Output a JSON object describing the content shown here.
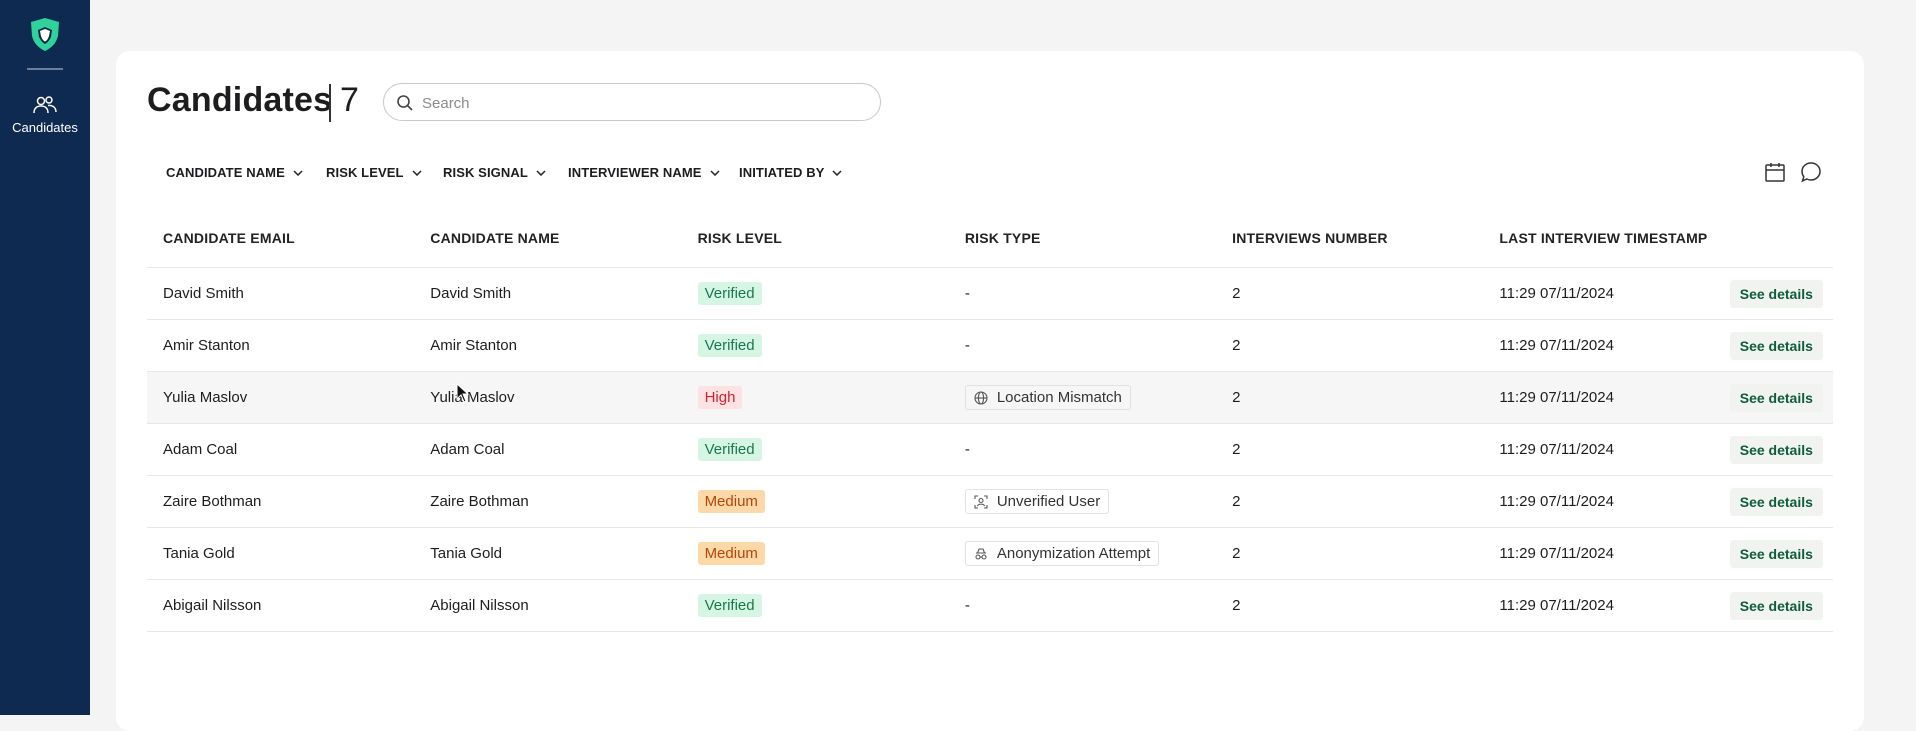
{
  "sidebar": {
    "logo_icon": "shield-logo",
    "items": [
      {
        "label": "Candidates",
        "icon": "users-icon"
      }
    ]
  },
  "header": {
    "title": "Candidates",
    "count": "7"
  },
  "search": {
    "placeholder": "Search",
    "value": ""
  },
  "filters": [
    "CANDIDATE NAME",
    "RISK LEVEL",
    "RISK SIGNAL",
    "INTERVIEWER NAME",
    "INITIATED BY"
  ],
  "table": {
    "headers": [
      "CANDIDATE EMAIL",
      "CANDIDATE NAME",
      "RISK LEVEL",
      "RISK TYPE",
      "INTERVIEWS NUMBER",
      "LAST INTERVIEW TIMESTAMP"
    ],
    "rows": [
      {
        "email": "David Smith",
        "name": "David Smith",
        "risk": "Verified",
        "risk_type": "-",
        "risk_type_icon": "",
        "interviews": "2",
        "timestamp": "11:29 07/11/2024",
        "action": "See details"
      },
      {
        "email": "Amir Stanton",
        "name": "Amir Stanton",
        "risk": "Verified",
        "risk_type": "-",
        "risk_type_icon": "",
        "interviews": "2",
        "timestamp": "11:29 07/11/2024",
        "action": "See details"
      },
      {
        "email": "Yulia Maslov",
        "name": "Yulia Maslov",
        "risk": "High",
        "risk_type": "Location Mismatch",
        "risk_type_icon": "globe-icon",
        "interviews": "2",
        "timestamp": "11:29 07/11/2024",
        "action": "See details"
      },
      {
        "email": "Adam Coal",
        "name": "Adam Coal",
        "risk": "Verified",
        "risk_type": "-",
        "risk_type_icon": "",
        "interviews": "2",
        "timestamp": "11:29 07/11/2024",
        "action": "See details"
      },
      {
        "email": "Zaire Bothman",
        "name": "Zaire Bothman",
        "risk": "Medium",
        "risk_type": "Unverified User",
        "risk_type_icon": "user-scan-icon",
        "interviews": "2",
        "timestamp": "11:29 07/11/2024",
        "action": "See details"
      },
      {
        "email": "Tania Gold",
        "name": "Tania Gold",
        "risk": "Medium",
        "risk_type": "Anonymization Attempt",
        "risk_type_icon": "incognito-icon",
        "interviews": "2",
        "timestamp": "11:29 07/11/2024",
        "action": "See details"
      },
      {
        "email": "Abigail Nilsson",
        "name": "Abigail Nilsson",
        "risk": "Verified",
        "risk_type": "-",
        "risk_type_icon": "",
        "interviews": "2",
        "timestamp": "11:29 07/11/2024",
        "action": "See details"
      }
    ]
  },
  "toolbar_icons": [
    "calendar-icon",
    "chat-icon"
  ],
  "colors": {
    "sidebar_bg": "#0f2a50",
    "brand_green": "#2fd39a",
    "verified_bg": "#d6f5e3",
    "high_bg": "#fde2e4",
    "medium_bg": "#fdd8a8"
  }
}
